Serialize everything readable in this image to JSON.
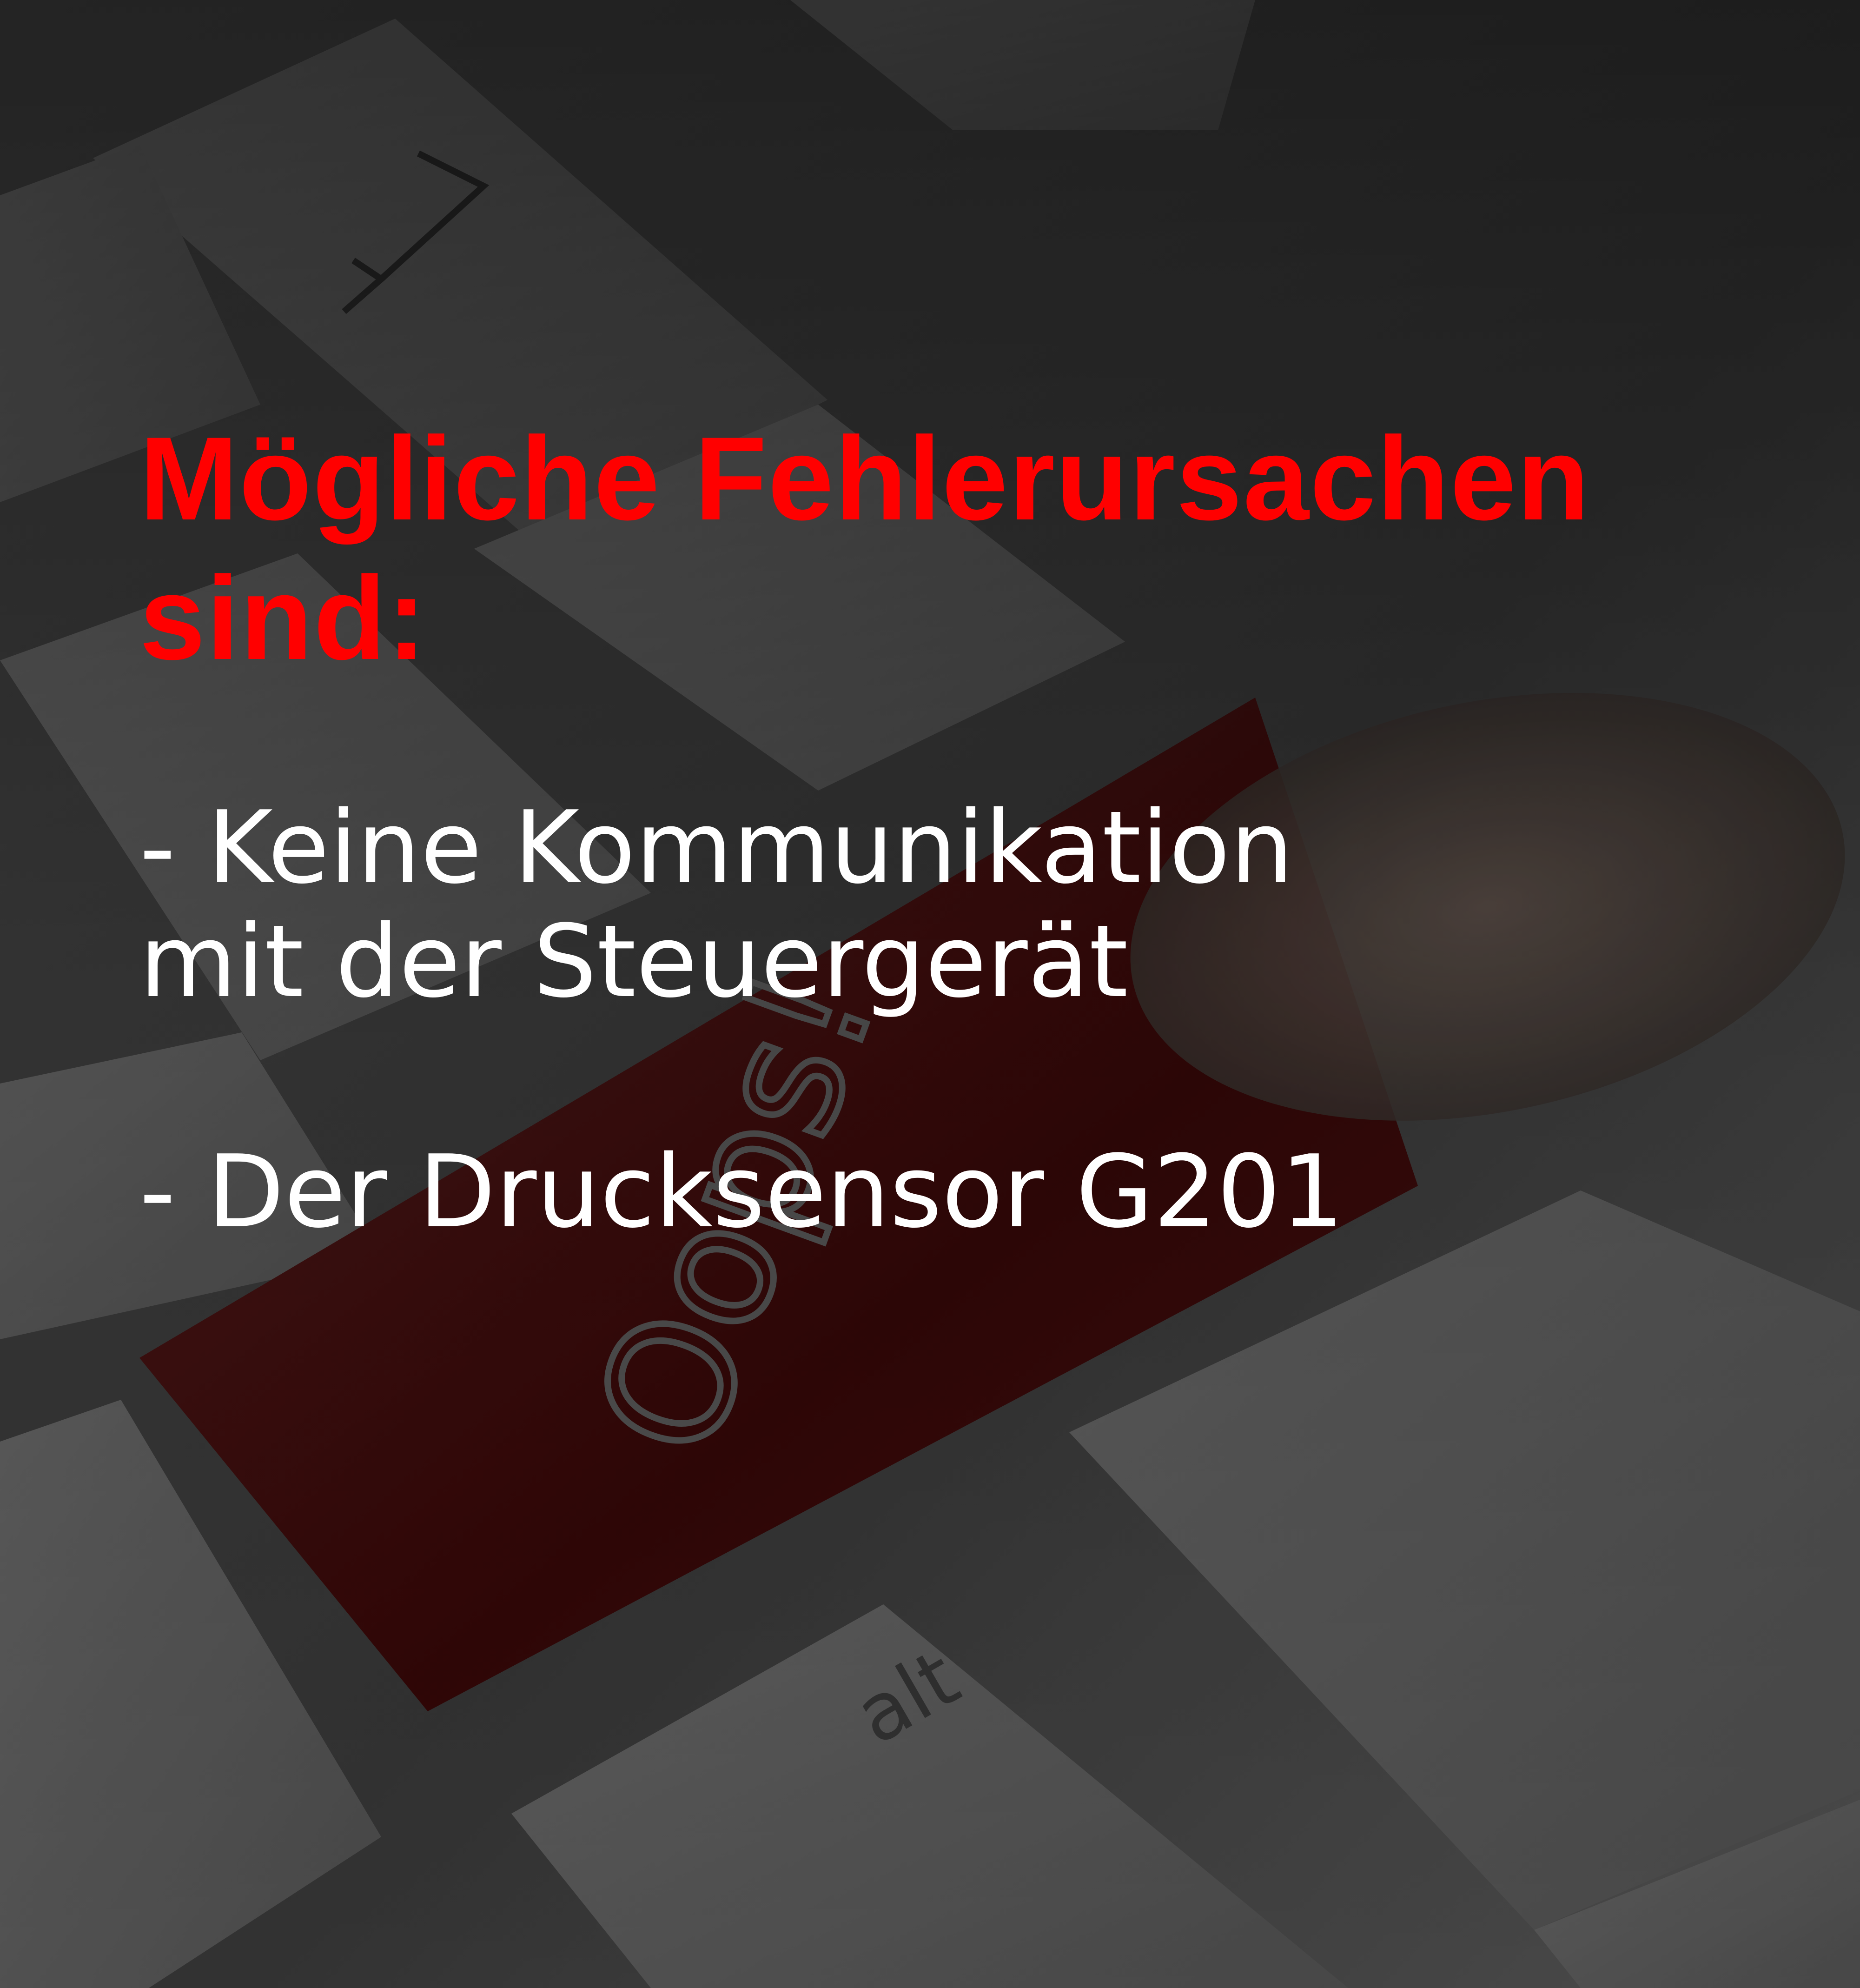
{
  "headline": "Mögliche Fehlerursachen sind:",
  "causes": [
    "- Keine Kommunikation\nmit der Steuergerät",
    "- Der Drucksensor G201"
  ],
  "photo": {
    "key_oops_label": "Oops!",
    "key_alt_label": "alt"
  },
  "colors": {
    "headline": "#ff0000",
    "body_text": "#ffffff",
    "oops_key": "#6a1414",
    "dark_overlay": "#1a1a1a"
  }
}
